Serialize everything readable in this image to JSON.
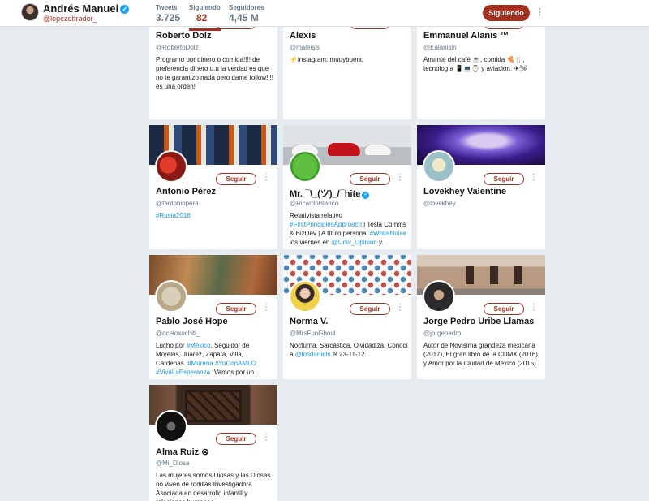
{
  "header": {
    "name": "Andrés Manuel",
    "verified_mark": "✓",
    "handle": "@lopezobrador_",
    "stats": [
      {
        "label": "Tweets",
        "value": "3.725"
      },
      {
        "label": "Siguiendo",
        "value": "82"
      },
      {
        "label": "Seguidores",
        "value": "4,45 M"
      }
    ],
    "follow_label": "Siguiendo",
    "more_icon": "⋮"
  },
  "colors": {
    "accent": "#a4301f",
    "link": "#1b95e0",
    "verified": "#1da1f2",
    "background": "#e6ecf0"
  },
  "follow_label": "Seguir",
  "more_icon": "⋮",
  "cards": [
    {
      "name": "Roberto Dolz",
      "handle": "@RobertoDolz",
      "bio": [
        {
          "t": "Programo por dinero o comida!!!! de preferencia dinero u.u la verdad es que no te garantizo nada pero dame follow!!!! es una orden!"
        }
      ]
    },
    {
      "name": "Alexis",
      "handle": "@maleisis",
      "bio": [
        {
          "t": "⚡instagram: muuybueno"
        }
      ]
    },
    {
      "name": "Emmanuel Alanis  ™",
      "handle": "@Ealanisln",
      "bio": [
        {
          "t": "Amante del café ☕, comida 🍕🍴, tecnología 📱💻⌚ y aviación. ✈🛩"
        }
      ]
    },
    {
      "name": "Antonio Pérez",
      "handle": "@fantoniopera",
      "bio": [
        {
          "t": "#Rusia2018",
          "link": true
        }
      ]
    },
    {
      "name": "Mr. ¯\\_(ツ)_/¯hite",
      "verified": true,
      "handle": "@RicardoBlanco",
      "bio": [
        {
          "t": "Relativista relativo "
        },
        {
          "t": "#FirstPrinciplesApproach",
          "link": true
        },
        {
          "t": " | Tesla Comms & BizDev | A título personal "
        },
        {
          "t": "#WhiteNoise",
          "link": true
        },
        {
          "t": " los viernes en "
        },
        {
          "t": "@Univ_Opinion",
          "link": true
        },
        {
          "t": " y..."
        }
      ]
    },
    {
      "name": "Lovekhey Valentine",
      "handle": "@lovekhey",
      "bio": []
    },
    {
      "name": "Pablo José Hope",
      "handle": "@oceloxochiti_",
      "bio": [
        {
          "t": "Lucho por "
        },
        {
          "t": "#México",
          "link": true
        },
        {
          "t": ". Seguidor de Morelos, Juárez, Zapata, Villa, Cárdenas. "
        },
        {
          "t": "#Morena",
          "link": true
        },
        {
          "t": " "
        },
        {
          "t": "#YoConAMLO",
          "link": true
        },
        {
          "t": " "
        },
        {
          "t": "#VivaLaEsperanza",
          "link": true
        },
        {
          "t": " ¡Vamos por un..."
        }
      ]
    },
    {
      "name": "Norma V.",
      "handle": "@MrsFunGhoul",
      "bio": [
        {
          "t": "Nocturna. Sarcástica. Olvidadiza. Conocí a "
        },
        {
          "t": "@losdaniels",
          "link": true
        },
        {
          "t": " el 23-11-12."
        }
      ]
    },
    {
      "name": "Jorge Pedro Uribe Llamas",
      "handle": "@jorgepedro",
      "bio": [
        {
          "t": "Autor de Novísima grandeza mexicana (2017), El gran libro de la CDMX (2016) y Amor por la Ciudad de México (2015)."
        }
      ]
    },
    {
      "name": "Alma Ruiz ⊗",
      "handle": "@Mi_Diosa",
      "bio": [
        {
          "t": "Las mujeres somos Diosas y las Diosas no viven de rodillas.Investigadora Asociada en desarrollo infantil y relaciones humanas."
        }
      ]
    }
  ],
  "card_visuals": [
    {
      "banner": "banner-cropped-roberto",
      "avatar": "avatar-sunglasses-man"
    },
    {
      "banner": "banner-cropped-alexis",
      "avatar": "avatar-alexis"
    },
    {
      "banner": "banner-cropped-emmanuel",
      "avatar": "avatar-bearded-man"
    },
    {
      "banner": "banner-football-players",
      "avatar": "avatar-red-helmet"
    },
    {
      "banner": "banner-tesla-cars",
      "avatar": "avatar-tree-hugger-logo"
    },
    {
      "banner": "banner-cosmic-face",
      "avatar": "avatar-illustration"
    },
    {
      "banner": "banner-mural-painting",
      "avatar": "avatar-mexican-eagle-coin"
    },
    {
      "banner": "banner-color-dots",
      "avatar": "avatar-woman-glasses"
    },
    {
      "banner": "banner-colonial-building",
      "avatar": "avatar-man-hat"
    },
    {
      "banner": "banner-wooden-door",
      "avatar": "avatar-dark-face"
    }
  ]
}
